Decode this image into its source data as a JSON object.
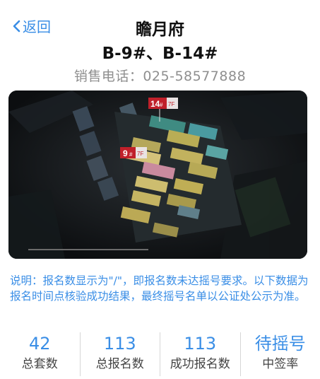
{
  "nav": {
    "back_label": "返回"
  },
  "header": {
    "project_name": "瞻月府",
    "buildings": "B-9#、B-14#",
    "phone": "销售电话：025-58577888"
  },
  "rendering": {
    "tag_a_number": "14",
    "tag_a_suffix": "#",
    "tag_a_floors": "7F",
    "tag_b_number": "9",
    "tag_b_suffix": "#",
    "tag_b_floors": "7F"
  },
  "note": "说明：报名数显示为\"/\"，即报名数未达摇号要求。以下数据为报名时间点核验成功结果，最终摇号名单以公证处公示为准。",
  "stats": [
    {
      "value": "42",
      "label": "总套数"
    },
    {
      "value": "113",
      "label": "总报名数"
    },
    {
      "value": "113",
      "label": "成功报名数"
    },
    {
      "value": "待摇号",
      "label": "中签率"
    }
  ],
  "colors": {
    "accent": "#3a8ee6",
    "tag_red": "#c0202a"
  }
}
